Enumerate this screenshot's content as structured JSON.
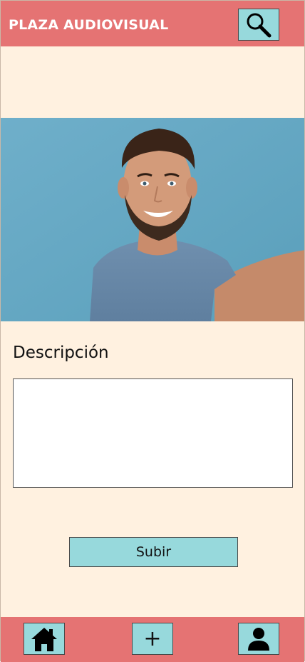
{
  "header": {
    "title": "PLAZA AUDIOVISUAL",
    "search_icon": "search-icon"
  },
  "photo": {
    "subject": "smiling man taking a selfie"
  },
  "form": {
    "description_label": "Descripción",
    "description_value": "",
    "submit_label": "Subir"
  },
  "footer": {
    "home_icon": "home-icon",
    "add_label": "+",
    "profile_icon": "user-icon"
  },
  "colors": {
    "header_bg": "#e57373",
    "page_bg": "#fff1e0",
    "button_bg": "#97d9dc"
  }
}
